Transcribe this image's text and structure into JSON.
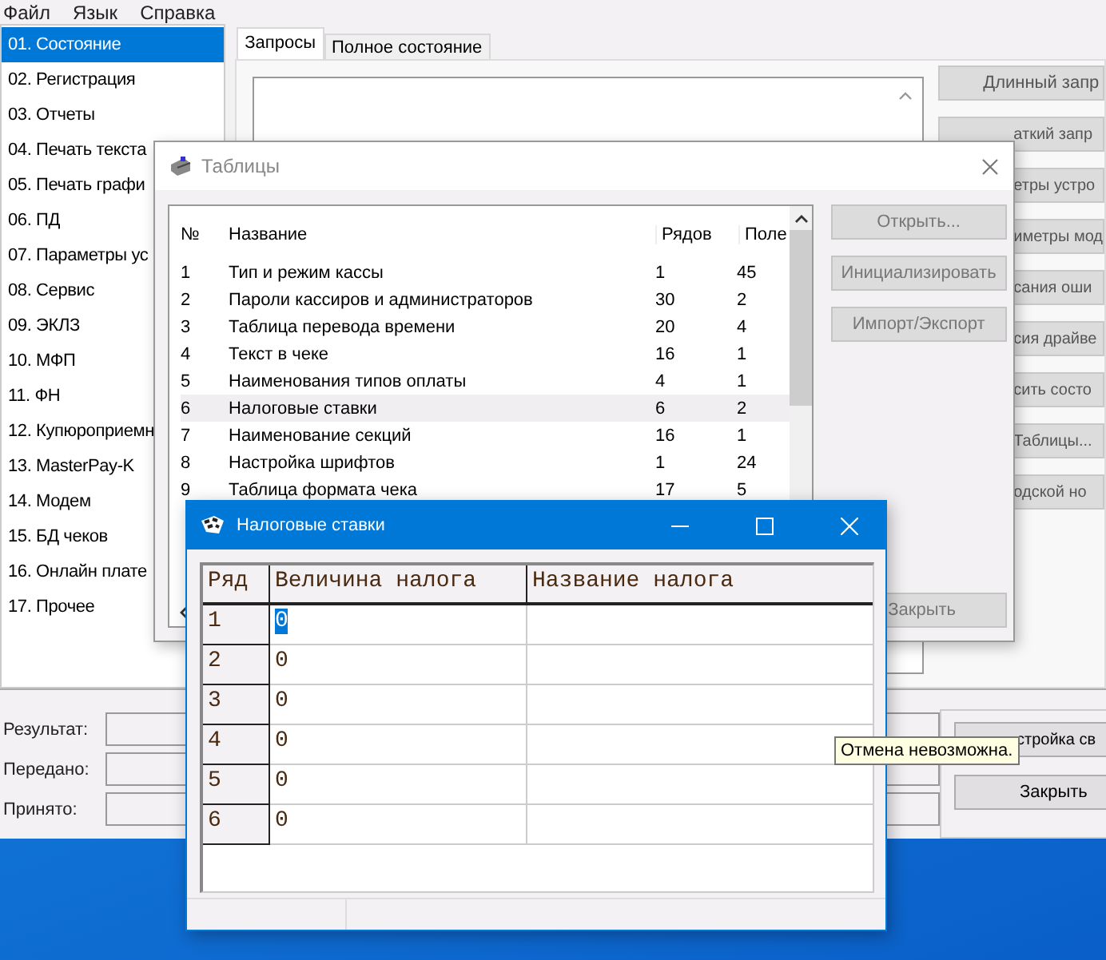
{
  "menu": [
    "Файл",
    "Язык",
    "Справка"
  ],
  "sidebar": {
    "items": [
      {
        "label": "01. Состояние",
        "selected": true
      },
      {
        "label": "02. Регистрация",
        "selected": false
      },
      {
        "label": "03. Отчеты",
        "selected": false
      },
      {
        "label": "04. Печать текста",
        "selected": false
      },
      {
        "label": "05. Печать графи",
        "selected": false
      },
      {
        "label": "06. ПД",
        "selected": false
      },
      {
        "label": "07. Параметры ус",
        "selected": false
      },
      {
        "label": "08. Сервис",
        "selected": false
      },
      {
        "label": "09. ЭКЛЗ",
        "selected": false
      },
      {
        "label": "10. МФП",
        "selected": false
      },
      {
        "label": "11. ФН",
        "selected": false
      },
      {
        "label": "12. Купюроприемн",
        "selected": false
      },
      {
        "label": "13. MasterPay-K",
        "selected": false
      },
      {
        "label": "14. Модем",
        "selected": false
      },
      {
        "label": "15. БД чеков",
        "selected": false
      },
      {
        "label": "16. Онлайн плате",
        "selected": false
      },
      {
        "label": "17. Прочее",
        "selected": false
      }
    ]
  },
  "tabs": [
    {
      "label": "Запросы",
      "selected": true
    },
    {
      "label": "Полное состояние",
      "selected": false
    }
  ],
  "side_buttons": [
    "Длинный запр",
    "аткий запр",
    "етры устро",
    "иметры мод",
    "сания оши",
    "сия драйве",
    "сить состо",
    "Таблицы...",
    "одской но"
  ],
  "status_fields": [
    "Результат:",
    "Передано:",
    "Принято:"
  ],
  "bottom_buttons": [
    "стройка св",
    "Закрыть"
  ],
  "tables_dialog": {
    "title": "Таблицы",
    "columns": [
      "№",
      "Название",
      "Рядов",
      "Поле"
    ],
    "rows": [
      {
        "cells": [
          "1",
          "Тип и режим кассы",
          "1",
          "45"
        ],
        "selected": false
      },
      {
        "cells": [
          "2",
          "Пароли кассиров и администраторов",
          "30",
          "2"
        ],
        "selected": false
      },
      {
        "cells": [
          "3",
          "Таблица перевода времени",
          "20",
          "4"
        ],
        "selected": false
      },
      {
        "cells": [
          "4",
          "Текст в чеке",
          "16",
          "1"
        ],
        "selected": false
      },
      {
        "cells": [
          "5",
          "Наименования типов оплаты",
          "4",
          "1"
        ],
        "selected": false
      },
      {
        "cells": [
          "6",
          "Налоговые ставки",
          "6",
          "2"
        ],
        "selected": true
      },
      {
        "cells": [
          "7",
          "Наименование секций",
          "16",
          "1"
        ],
        "selected": false
      },
      {
        "cells": [
          "8",
          "Настройка шрифтов",
          "1",
          "24"
        ],
        "selected": false
      },
      {
        "cells": [
          "9",
          "Таблица формата чека",
          "17",
          "5"
        ],
        "selected": false
      }
    ],
    "buttons": [
      {
        "label": "Открыть...",
        "disabled": true
      },
      {
        "label": "Инициализировать",
        "disabled": true
      },
      {
        "label": "Импорт/Экспорт",
        "disabled": true
      }
    ],
    "close_button": {
      "label": "Закрыть",
      "disabled": true
    }
  },
  "tax_window": {
    "title": "Налоговые ставки",
    "columns": [
      "Ряд",
      "Величина налога",
      "Название налога"
    ],
    "rows": [
      {
        "number": "1",
        "rate": "0",
        "selected": true
      },
      {
        "number": "2",
        "rate": "0",
        "selected": false
      },
      {
        "number": "3",
        "rate": "0",
        "selected": false
      },
      {
        "number": "4",
        "rate": "0",
        "selected": false
      },
      {
        "number": "5",
        "rate": "0",
        "selected": false
      },
      {
        "number": "6",
        "rate": "0",
        "selected": false
      }
    ]
  },
  "tooltip": "Отмена невозможна."
}
